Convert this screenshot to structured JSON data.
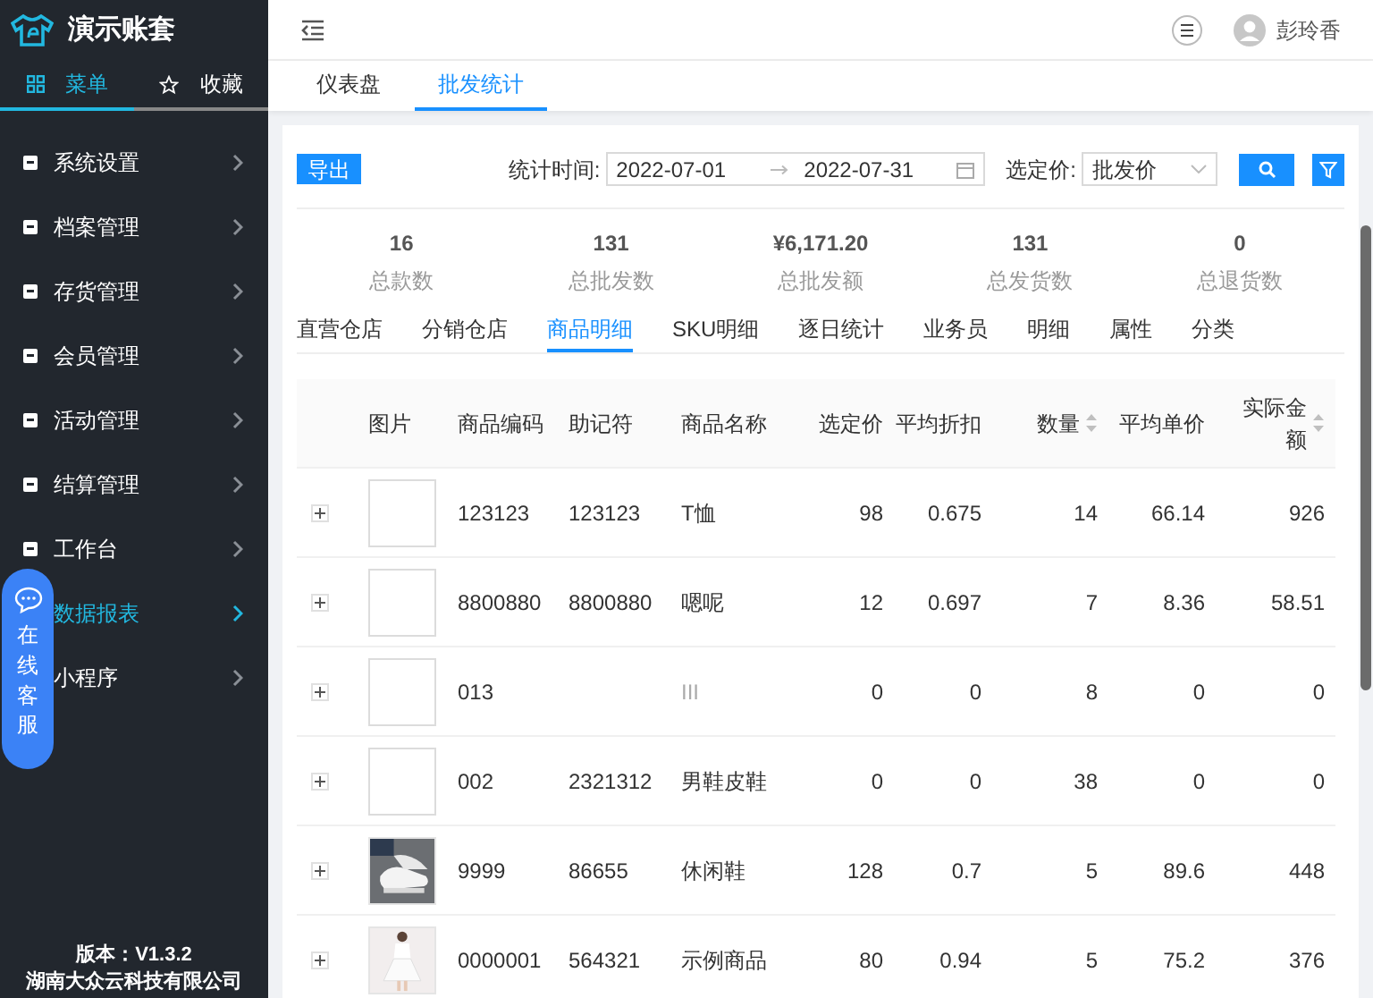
{
  "brand": {
    "title": "演示账套"
  },
  "sidebar_tabs": [
    {
      "label": "菜单",
      "kind": "grid",
      "selected": true
    },
    {
      "label": "收藏",
      "kind": "star",
      "selected": false
    }
  ],
  "menu": [
    {
      "label": "系统设置",
      "selected": false
    },
    {
      "label": "档案管理",
      "selected": false
    },
    {
      "label": "存货管理",
      "selected": false
    },
    {
      "label": "会员管理",
      "selected": false
    },
    {
      "label": "活动管理",
      "selected": false
    },
    {
      "label": "结算管理",
      "selected": false
    },
    {
      "label": "工作台",
      "selected": false
    },
    {
      "label": "数据报表",
      "selected": true,
      "covered": true
    },
    {
      "label": "小程序",
      "selected": false,
      "covered": true
    }
  ],
  "chat_button": {
    "label": "在线客服"
  },
  "footer": {
    "version": "版本：V1.3.2",
    "company": "湖南大众云科技有限公司"
  },
  "user": {
    "name": "彭玲香"
  },
  "page_tabs": [
    {
      "label": "仪表盘",
      "selected": false
    },
    {
      "label": "批发统计",
      "selected": true
    }
  ],
  "toolbar": {
    "export": "导出",
    "date_label": "统计时间:",
    "start": "2022-07-01",
    "end": "2022-07-31",
    "price_label": "选定价:",
    "price": "批发价"
  },
  "stats": [
    {
      "value": "16",
      "label": "总款数"
    },
    {
      "value": "131",
      "label": "总批发数"
    },
    {
      "value": "¥6,171.20",
      "label": "总批发额"
    },
    {
      "value": "131",
      "label": "总发货数"
    },
    {
      "value": "0",
      "label": "总退货数"
    }
  ],
  "report_tabs": [
    {
      "label": "直营仓店",
      "selected": false
    },
    {
      "label": "分销仓店",
      "selected": false
    },
    {
      "label": "商品明细",
      "selected": true
    },
    {
      "label": "SKU明细",
      "selected": false
    },
    {
      "label": "逐日统计",
      "selected": false
    },
    {
      "label": "业务员",
      "selected": false
    },
    {
      "label": "明细",
      "selected": false
    },
    {
      "label": "属性",
      "selected": false
    },
    {
      "label": "分类",
      "selected": false
    }
  ],
  "table": {
    "columns": [
      {
        "label": "图片",
        "sortable": false
      },
      {
        "label": "商品编码",
        "sortable": false
      },
      {
        "label": "助记符",
        "sortable": false
      },
      {
        "label": "商品名称",
        "sortable": false
      },
      {
        "label": "选定价",
        "sortable": false
      },
      {
        "label": "平均折扣",
        "sortable": false
      },
      {
        "label": "数量",
        "sortable": true
      },
      {
        "label": "平均单价",
        "sortable": false
      },
      {
        "label": "实际金额",
        "sortable": true
      }
    ],
    "rows": [
      {
        "cells": [
          {
            "kind": "placeholder"
          },
          "123123",
          "123123",
          "T恤",
          "98",
          "0.675",
          "14",
          "66.14",
          "926"
        ],
        "muted": false
      },
      {
        "cells": [
          {
            "kind": "placeholder"
          },
          "8800880",
          "8800880",
          "嗯呢",
          "12",
          "0.697",
          "7",
          "8.36",
          "58.51"
        ],
        "muted": false
      },
      {
        "cells": [
          {
            "kind": "placeholder"
          },
          "013",
          null,
          "III",
          "0",
          "0",
          "8",
          "0",
          "0"
        ],
        "muted": true
      },
      {
        "cells": [
          {
            "kind": "placeholder"
          },
          "002",
          "2321312",
          "男鞋皮鞋",
          "0",
          "0",
          "38",
          "0",
          "0"
        ],
        "muted": false
      },
      {
        "cells": [
          {
            "kind": "picture"
          },
          "9999",
          "86655",
          "休闲鞋",
          "128",
          "0.7",
          "5",
          "89.6",
          "448"
        ],
        "muted": false
      },
      {
        "cells": [
          {
            "kind": "picture"
          },
          "0000001",
          "564321",
          "示例商品",
          "80",
          "0.94",
          "5",
          "75.2",
          "376"
        ],
        "muted": false
      }
    ]
  }
}
